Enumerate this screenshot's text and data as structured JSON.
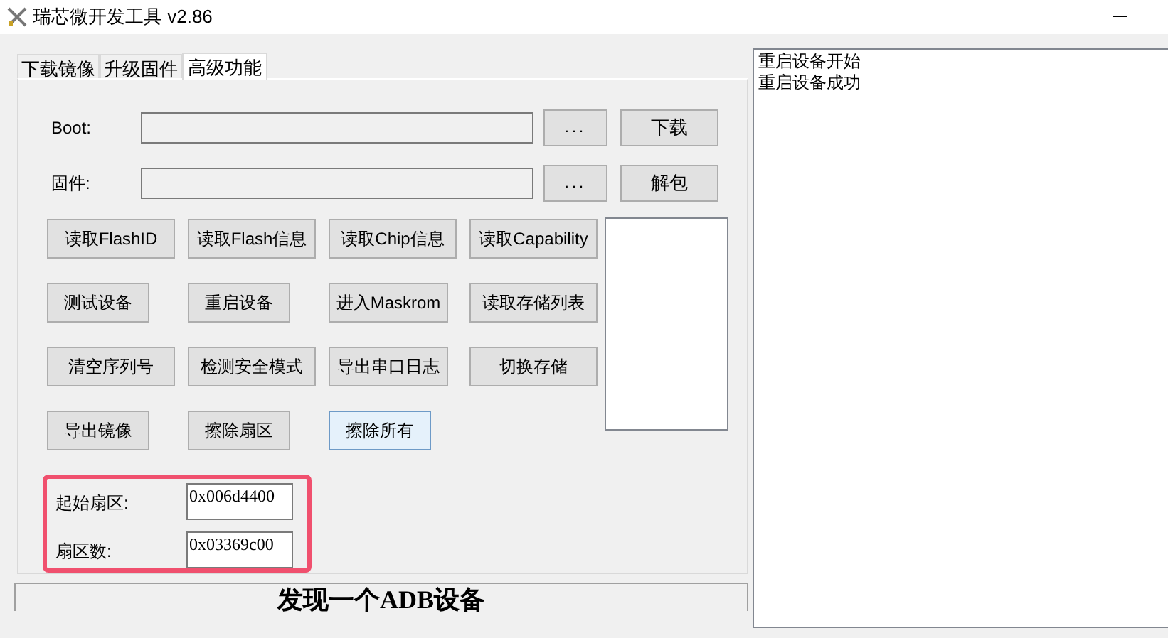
{
  "window": {
    "title": "瑞芯微开发工具 v2.86"
  },
  "tabs": [
    {
      "label": "下载镜像",
      "selected": false
    },
    {
      "label": "升级固件",
      "selected": false
    },
    {
      "label": "高级功能",
      "selected": true
    }
  ],
  "file_rows": [
    {
      "label": "Boot:",
      "browse": "...",
      "action": "下载"
    },
    {
      "label": "固件:",
      "browse": "...",
      "action": "解包"
    }
  ],
  "buttons": [
    {
      "label": "读取FlashID",
      "focused": false
    },
    {
      "label": "读取Flash信息",
      "focused": false
    },
    {
      "label": "读取Chip信息",
      "focused": false
    },
    {
      "label": "读取Capability",
      "focused": false
    },
    {
      "label": "测试设备",
      "focused": false
    },
    {
      "label": "重启设备",
      "focused": false
    },
    {
      "label": "进入Maskrom",
      "focused": false
    },
    {
      "label": "读取存储列表",
      "focused": false
    },
    {
      "label": "清空序列号",
      "focused": false
    },
    {
      "label": "检测安全模式",
      "focused": false
    },
    {
      "label": "导出串口日志",
      "focused": false
    },
    {
      "label": "切换存储",
      "focused": false
    },
    {
      "label": "导出镜像",
      "focused": false
    },
    {
      "label": "擦除扇区",
      "focused": false
    },
    {
      "label": "擦除所有",
      "focused": true
    }
  ],
  "sector_fields": [
    {
      "label": "起始扇区:",
      "value": "0x006d4400"
    },
    {
      "label": "扇区数:",
      "value": "0x03369c00"
    }
  ],
  "status_bar": "发现一个ADB设备",
  "log": [
    "重启设备开始",
    "重启设备成功"
  ]
}
